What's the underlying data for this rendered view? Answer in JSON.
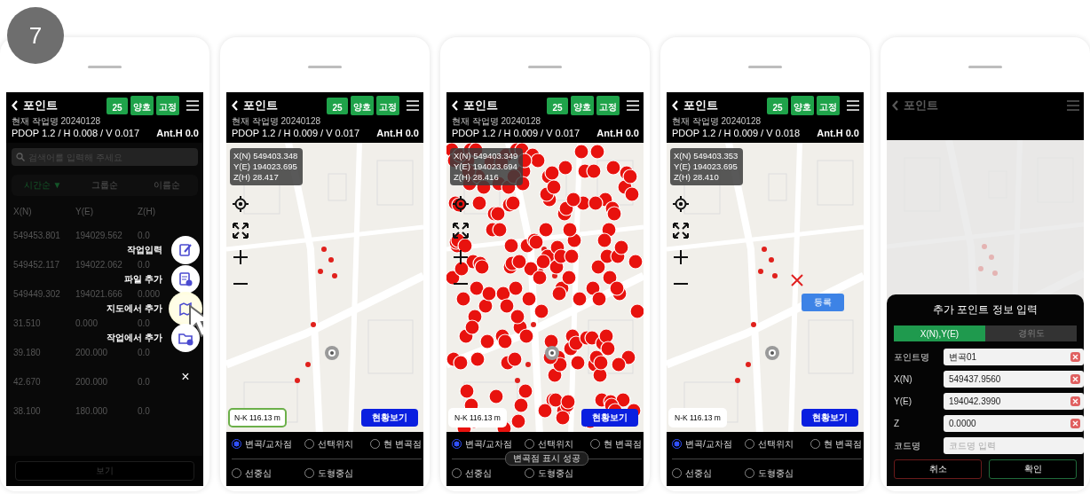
{
  "step_badge": "7",
  "phones": [
    {
      "kind": "list",
      "header": {
        "title": "포인트",
        "badges": [
          "25",
          "양호",
          "고정"
        ],
        "job": "현재 작업명 20240128",
        "precision": "PDOP 1.2 / H 0.008 / V 0.017",
        "antenna": "Ant.H 0.0"
      },
      "search": {
        "placeholder": "검색어를 입력해 주세요"
      },
      "sort_tabs": [
        {
          "label": "시간순 ▼",
          "selected": true
        },
        {
          "label": "그룹순",
          "selected": false
        },
        {
          "label": "이름순",
          "selected": false
        }
      ],
      "columns": [
        "X(N)",
        "Y(E)",
        "Z(H)"
      ],
      "rows": [
        [
          "549453.801",
          "194029.562",
          "0.0"
        ],
        [
          "549452.117",
          "194022.062",
          "0.0"
        ],
        [
          "549449.302",
          "194021.666",
          "0.000"
        ],
        [
          "31.510",
          "0.000",
          "0.0"
        ],
        [
          "39.180",
          "200.000",
          "0.0"
        ],
        [
          "42.670",
          "200.000",
          "0.0"
        ],
        [
          "38.100",
          "180.000",
          "0.0"
        ]
      ],
      "fab_menu": {
        "open": true,
        "items": [
          {
            "label": "작업입력",
            "kind": "edit",
            "pressed": false
          },
          {
            "label": "파일 추가",
            "kind": "file",
            "pressed": false
          },
          {
            "label": "지도에서 추가",
            "kind": "map",
            "pressed": true
          },
          {
            "label": "작업에서 추가",
            "kind": "folder",
            "pressed": false
          }
        ],
        "close": "×"
      },
      "bottom_button": "보기"
    },
    {
      "kind": "map",
      "header": {
        "title": "포인트",
        "badges": [
          "25",
          "양호",
          "고정"
        ],
        "job": "현재 작업명 20240128",
        "precision": "PDOP 1.2 / H 0.009 / V 0.017",
        "antenna": "Ant.H 0.0"
      },
      "coords": [
        "X(N) 549403.348",
        "Y(E) 194023.695",
        "Z(H) 28.417"
      ],
      "inflection_points_shown": false,
      "scale": {
        "label": "N-K 116.13 m",
        "highlighted": true
      },
      "status_button": "현황보기",
      "snap_options": [
        {
          "label": "변곡/교차점",
          "selected": true
        },
        {
          "label": "선택위치",
          "selected": false
        },
        {
          "label": "현 변곡점",
          "selected": false
        },
        {
          "label": "선중심",
          "selected": false
        },
        {
          "label": "도형중심",
          "selected": false
        }
      ]
    },
    {
      "kind": "map",
      "header": {
        "title": "포인트",
        "badges": [
          "25",
          "양호",
          "고정"
        ],
        "job": "현재 작업명 20240128",
        "precision": "PDOP 1.2 / H 0.009 / V 0.017",
        "antenna": "Ant.H 0.0"
      },
      "coords": [
        "X(N) 549403.349",
        "Y(E) 194023.694",
        "Z(H) 28.416"
      ],
      "inflection_points_shown": true,
      "scale": {
        "label": "N-K 116.13 m",
        "highlighted": false
      },
      "status_button": "현황보기",
      "snap_options": [
        {
          "label": "변곡/교차점",
          "selected": true
        },
        {
          "label": "선택위치",
          "selected": false
        },
        {
          "label": "현 변곡점",
          "selected": false
        },
        {
          "label": "선중심",
          "selected": false
        },
        {
          "label": "도형중심",
          "selected": false
        }
      ],
      "toast": "변곡점 표시 성공"
    },
    {
      "kind": "map",
      "header": {
        "title": "포인트",
        "badges": [
          "25",
          "양호",
          "고정"
        ],
        "job": "현재 작업명 20240128",
        "precision": "PDOP 1.2 / H 0.009 / V 0.018",
        "antenna": "Ant.H 0.0"
      },
      "coords": [
        "X(N) 549403.353",
        "Y(E) 194023.695",
        "Z(H) 28.410"
      ],
      "inflection_points_shown": false,
      "scale": {
        "label": "N-K 116.13 m",
        "highlighted": false
      },
      "status_button": "현황보기",
      "snap_options": [
        {
          "label": "변곡/교차점",
          "selected": true
        },
        {
          "label": "선택위치",
          "selected": false
        },
        {
          "label": "현 변곡점",
          "selected": false
        },
        {
          "label": "선중심",
          "selected": false
        },
        {
          "label": "도형중심",
          "selected": false
        }
      ],
      "pin_button": "등록"
    },
    {
      "kind": "form",
      "header": {
        "title": "포인트"
      },
      "dialog": {
        "title": "추가 포인트 정보 입력",
        "tabs": [
          {
            "label": "X(N),Y(E)",
            "selected": true
          },
          {
            "label": "경위도",
            "selected": false
          }
        ],
        "fields": [
          {
            "label": "포인트명",
            "value": "변곡01"
          },
          {
            "label": "X(N)",
            "value": "549437.9560"
          },
          {
            "label": "Y(E)",
            "value": "194042.3990"
          },
          {
            "label": "Z",
            "value": "0.0000"
          },
          {
            "label": "코드명",
            "placeholder": "코드명 입력"
          }
        ],
        "buttons": [
          {
            "label": "취소",
            "kind": "cancel"
          },
          {
            "label": "확인",
            "kind": "confirm"
          }
        ]
      }
    }
  ]
}
